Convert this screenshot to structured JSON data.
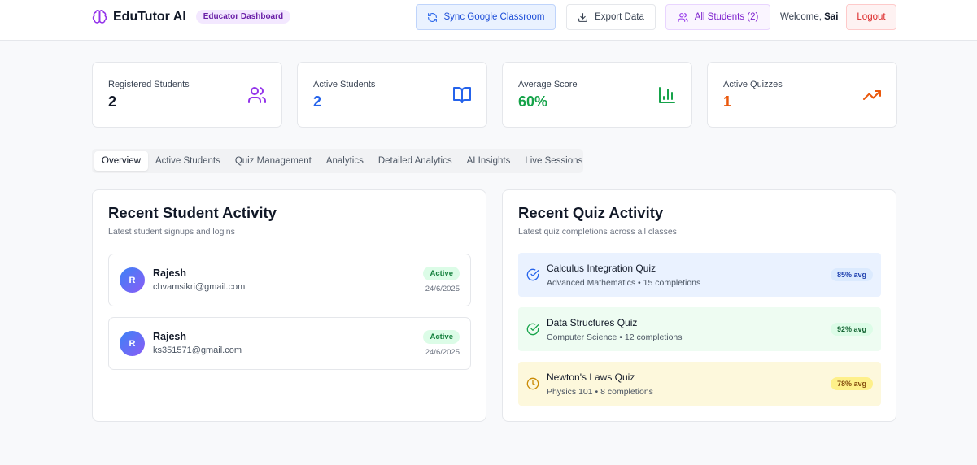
{
  "header": {
    "brand": "EduTutor AI",
    "role_badge": "Educator Dashboard",
    "buttons": {
      "sync": "Sync Google Classroom",
      "export": "Export Data",
      "students": "All Students (2)",
      "logout": "Logout"
    },
    "welcome_prefix": "Welcome,",
    "user_name": "Sai"
  },
  "stats": [
    {
      "label": "Registered Students",
      "value": "2",
      "color": "#111827",
      "icon": "users-icon",
      "icon_color": "#9333ea"
    },
    {
      "label": "Active Students",
      "value": "2",
      "color": "#2563eb",
      "icon": "book-open-icon",
      "icon_color": "#2563eb"
    },
    {
      "label": "Average Score",
      "value": "60%",
      "color": "#16a34a",
      "icon": "bar-chart-icon",
      "icon_color": "#16a34a"
    },
    {
      "label": "Active Quizzes",
      "value": "1",
      "color": "#ea580c",
      "icon": "trending-up-icon",
      "icon_color": "#ea580c"
    }
  ],
  "tabs": [
    "Overview",
    "Active Students",
    "Quiz Management",
    "Analytics",
    "Detailed Analytics",
    "AI Insights",
    "Live Sessions"
  ],
  "active_tab": "Overview",
  "student_activity": {
    "title": "Recent Student Activity",
    "subtitle": "Latest student signups and logins",
    "items": [
      {
        "initial": "R",
        "name": "Rajesh",
        "email": "chvamsikri@gmail.com",
        "status": "Active",
        "date": "24/6/2025"
      },
      {
        "initial": "R",
        "name": "Rajesh",
        "email": "ks351571@gmail.com",
        "status": "Active",
        "date": "24/6/2025"
      }
    ]
  },
  "quiz_activity": {
    "title": "Recent Quiz Activity",
    "subtitle": "Latest quiz completions across all classes",
    "items": [
      {
        "name": "Calculus Integration Quiz",
        "meta": "Advanced Mathematics • 15 completions",
        "avg": "85% avg",
        "tone": "blue",
        "icon": "check-circle-icon",
        "icon_color": "#2563eb"
      },
      {
        "name": "Data Structures Quiz",
        "meta": "Computer Science • 12 completions",
        "avg": "92% avg",
        "tone": "green",
        "icon": "check-circle-icon",
        "icon_color": "#16a34a"
      },
      {
        "name": "Newton's Laws Quiz",
        "meta": "Physics 101 • 8 completions",
        "avg": "78% avg",
        "tone": "yellow",
        "icon": "clock-icon",
        "icon_color": "#ca8a04"
      }
    ]
  }
}
